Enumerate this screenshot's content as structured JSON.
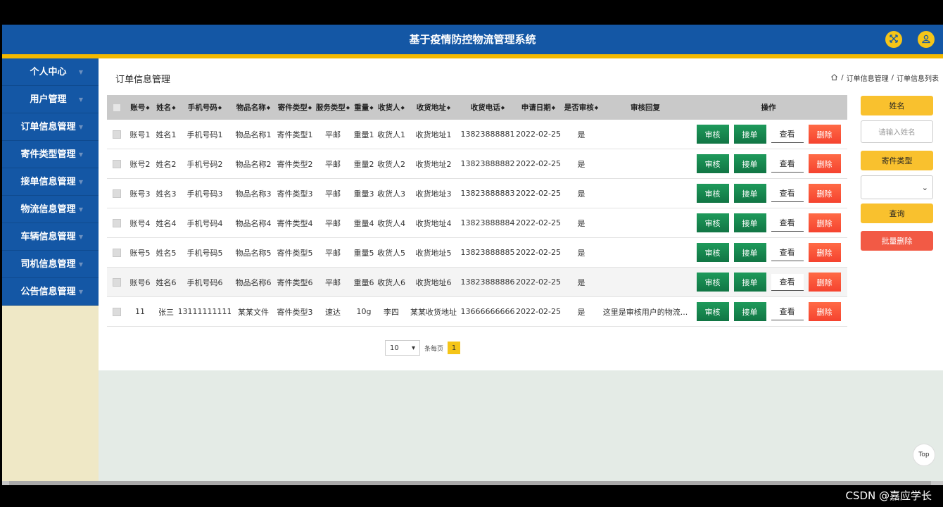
{
  "app": {
    "title": "基于疫情防控物流管理系统"
  },
  "header": {
    "icons": [
      "fullscreen-icon",
      "user-icon"
    ],
    "accent": "#1457a5",
    "stripe": "#f3b900"
  },
  "sidebar": {
    "items": [
      {
        "label": "个人中心"
      },
      {
        "label": "用户管理"
      },
      {
        "label": "订单信息管理"
      },
      {
        "label": "寄件类型管理"
      },
      {
        "label": "接单信息管理"
      },
      {
        "label": "物流信息管理"
      },
      {
        "label": "车辆信息管理"
      },
      {
        "label": "司机信息管理"
      },
      {
        "label": "公告信息管理"
      }
    ]
  },
  "page": {
    "title": "订单信息管理",
    "breadcrumb": [
      "订单信息管理",
      "订单信息列表"
    ],
    "crumb_sep": "/"
  },
  "table": {
    "headers": [
      "账号",
      "姓名",
      "手机号码",
      "物品名称",
      "寄件类型",
      "服务类型",
      "重量",
      "收货人",
      "收货地址",
      "收货电话",
      "申请日期",
      "是否审核",
      "审核回复",
      "操作"
    ],
    "sort_mark": "◆",
    "rows": [
      [
        "账号1",
        "姓名1",
        "手机号码1",
        "物品名称1",
        "寄件类型1",
        "平邮",
        "重量1",
        "收货人1",
        "收货地址1",
        "13823888881",
        "2022-02-25",
        "是",
        ""
      ],
      [
        "账号2",
        "姓名2",
        "手机号码2",
        "物品名称2",
        "寄件类型2",
        "平邮",
        "重量2",
        "收货人2",
        "收货地址2",
        "13823888882",
        "2022-02-25",
        "是",
        ""
      ],
      [
        "账号3",
        "姓名3",
        "手机号码3",
        "物品名称3",
        "寄件类型3",
        "平邮",
        "重量3",
        "收货人3",
        "收货地址3",
        "13823888883",
        "2022-02-25",
        "是",
        ""
      ],
      [
        "账号4",
        "姓名4",
        "手机号码4",
        "物品名称4",
        "寄件类型4",
        "平邮",
        "重量4",
        "收货人4",
        "收货地址4",
        "13823888884",
        "2022-02-25",
        "是",
        ""
      ],
      [
        "账号5",
        "姓名5",
        "手机号码5",
        "物品名称5",
        "寄件类型5",
        "平邮",
        "重量5",
        "收货人5",
        "收货地址5",
        "13823888885",
        "2022-02-25",
        "是",
        ""
      ],
      [
        "账号6",
        "姓名6",
        "手机号码6",
        "物品名称6",
        "寄件类型6",
        "平邮",
        "重量6",
        "收货人6",
        "收货地址6",
        "13823888886",
        "2022-02-25",
        "是",
        ""
      ],
      [
        "11",
        "张三",
        "13111111111",
        "某某文件",
        "寄件类型3",
        "速达",
        "10g",
        "李四",
        "某某收货地址",
        "13666666666",
        "2022-02-25",
        "是",
        "这里是审核用户的物流..."
      ]
    ],
    "actions": {
      "audit": "审核",
      "accept": "接单",
      "view": "查看",
      "delete": "删除"
    }
  },
  "pagination": {
    "page_size": "10",
    "per_page_label": "条每页",
    "current_page": "1"
  },
  "search_panel": {
    "name_label": "姓名",
    "name_placeholder": "请输入姓名",
    "type_label": "寄件类型",
    "type_value": "",
    "query_button": "查询",
    "batch_delete_button": "批量删除"
  },
  "back_to_top": "Top",
  "watermark": "CSDN @嘉应学长",
  "colors": {
    "green": "#1e9a5b",
    "red": "#f5432f",
    "yellow": "#f9c12e"
  }
}
